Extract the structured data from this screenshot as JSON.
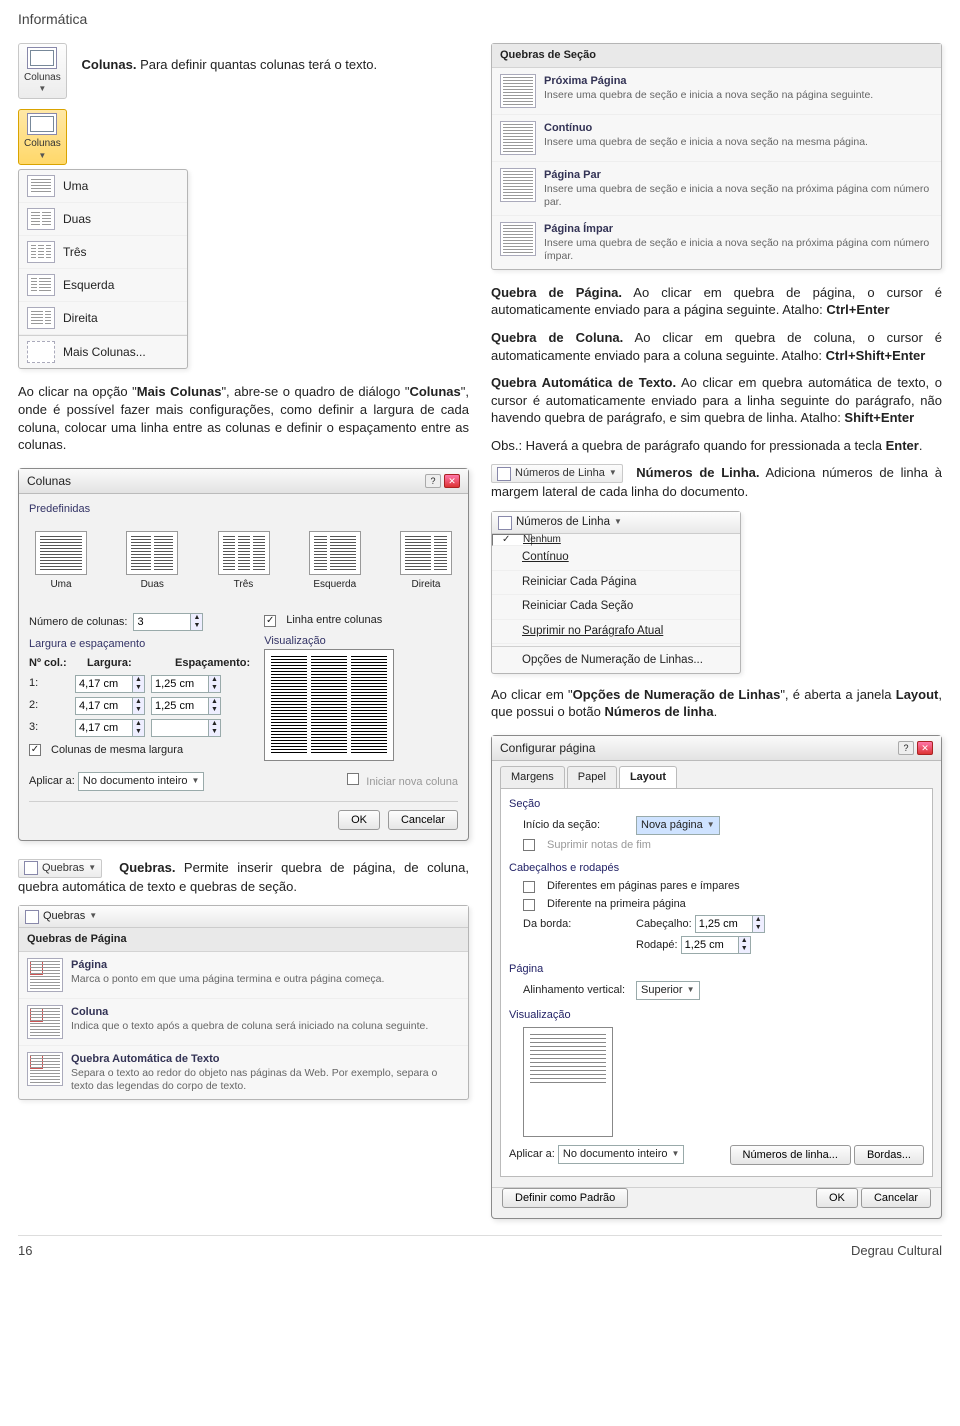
{
  "page_header": "Informática",
  "page_number": "16",
  "page_footer": "Degrau Cultural",
  "left": {
    "colunas_intro": {
      "label": "Colunas.",
      "text": " Para definir quantas colunas terá o texto.",
      "button": "Colunas"
    },
    "column_menu": {
      "button": "Colunas",
      "items": [
        "Uma",
        "Duas",
        "Três",
        "Esquerda",
        "Direita"
      ],
      "more": "Mais Colunas..."
    },
    "more_columns_para": {
      "p1a": "Ao clicar na opção \"",
      "p1b": "Mais Colunas",
      "p1c": "\", abre-se o quadro de diálogo \"",
      "p1d": "Colunas",
      "p1e": "\", onde é possível fazer mais configurações, como definir a largura de cada coluna, colocar uma linha entre as colunas e definir o espaçamento entre as colunas."
    },
    "columns_dialog": {
      "title": "Colunas",
      "predef_label": "Predefinidas",
      "presets": [
        "Uma",
        "Duas",
        "Três",
        "Esquerda",
        "Direita"
      ],
      "numcols_label": "Número de colunas:",
      "numcols_value": "3",
      "linha_entre": "Linha entre colunas",
      "larg_esp_label": "Largura e espaçamento",
      "visual_label": "Visualização",
      "col_no": "Nº col.:",
      "largura": "Largura:",
      "espac": "Espaçamento:",
      "rows": [
        {
          "n": "1:",
          "w": "4,17 cm",
          "s": "1,25 cm"
        },
        {
          "n": "2:",
          "w": "4,17 cm",
          "s": "1,25 cm"
        },
        {
          "n": "3:",
          "w": "4,17 cm",
          "s": ""
        }
      ],
      "mesma_larg": "Colunas de mesma largura",
      "aplicar_label": "Aplicar a:",
      "aplicar_value": "No documento inteiro",
      "iniciar_nova": "Iniciar nova coluna",
      "ok": "OK",
      "cancel": "Cancelar"
    },
    "quebras_para": {
      "btn": "Quebras",
      "b": "Quebras.",
      "t": " Permite inserir quebra de página, de coluna, quebra automática de texto e quebras de seção."
    },
    "quebras_gallery": {
      "button": "Quebras",
      "head": "Quebras de Página",
      "items": [
        {
          "t": "Página",
          "d": "Marca o ponto em que uma página termina e outra página começa."
        },
        {
          "t": "Coluna",
          "d": "Indica que o texto após a quebra de coluna será iniciado na coluna seguinte."
        },
        {
          "t": "Quebra Automática de Texto",
          "d": "Separa o texto ao redor do objeto nas páginas da Web. Por exemplo, separa o texto das legendas do corpo de texto."
        }
      ]
    }
  },
  "right": {
    "section_gallery": {
      "head": "Quebras de Seção",
      "items": [
        {
          "t": "Próxima Página",
          "d": "Insere uma quebra de seção e inicia a nova seção na página seguinte."
        },
        {
          "t": "Contínuo",
          "d": "Insere uma quebra de seção e inicia a nova seção na mesma página."
        },
        {
          "t": "Página Par",
          "d": "Insere uma quebra de seção e inicia a nova seção na próxima página com número par."
        },
        {
          "t": "Página Ímpar",
          "d": "Insere uma quebra de seção e inicia a nova seção na próxima página com número ímpar."
        }
      ]
    },
    "quebra_pagina": {
      "b": "Quebra de Página.",
      "t": " Ao clicar em quebra de página, o cursor é automaticamente enviado para a página seguinte. Atalho: ",
      "s": "Ctrl+Enter"
    },
    "quebra_coluna": {
      "b": "Quebra de Coluna.",
      "t": " Ao clicar em quebra de coluna, o cursor é automaticamente enviado para a coluna seguinte. Atalho: ",
      "s": "Ctrl+Shift+Enter"
    },
    "quebra_auto": {
      "b": "Quebra Automática de Texto.",
      "t": " Ao clicar em quebra automática de texto, o cursor é automaticamente enviado para a linha seguinte do parágrafo, não havendo quebra de parágrafo, e sim quebra de linha. Atalho: ",
      "s": "Shift+Enter"
    },
    "obs": {
      "p": "Obs.: Haverá a quebra de parágrafo quando for pressionada a tecla ",
      "b": "Enter",
      "end": "."
    },
    "num_linha": {
      "btn": "Números de Linha",
      "b": "Números de Linha.",
      "t": " Adiciona números de linha à margem lateral de cada linha do documento."
    },
    "ln_menu": {
      "head": "Números de Linha",
      "items": [
        "Nenhum",
        "Contínuo",
        "Reiniciar Cada Página",
        "Reiniciar Cada Seção",
        "Suprimir no Parágrafo Atual"
      ],
      "more": "Opções de Numeração de Linhas..."
    },
    "opcoes_para": {
      "p1": "Ao clicar em \"",
      "b1": "Opções de Numeração de Linhas",
      "p2": "\", é aberta a janela ",
      "b2": "Layout",
      "p3": ", que possui o botão ",
      "b3": "Números de linha",
      "p4": "."
    },
    "page_setup": {
      "title": "Configurar página",
      "tabs": [
        "Margens",
        "Papel",
        "Layout"
      ],
      "secao": "Seção",
      "inicio_secao_lbl": "Início da seção:",
      "inicio_secao_val": "Nova página",
      "suprimir": "Suprimir notas de fim",
      "cabe_rod": "Cabeçalhos e rodapés",
      "dif_par_impar": "Diferentes em páginas pares e ímpares",
      "dif_primeira": "Diferente na primeira página",
      "da_borda": "Da borda:",
      "cabecalho_lbl": "Cabeçalho:",
      "cabecalho_val": "1,25 cm",
      "rodape_lbl": "Rodapé:",
      "rodape_val": "1,25 cm",
      "pagina": "Página",
      "alinh_vert_lbl": "Alinhamento vertical:",
      "alinh_vert_val": "Superior",
      "visual": "Visualização",
      "aplicar_lbl": "Aplicar a:",
      "aplicar_val": "No documento inteiro",
      "btn_num_linha": "Números de linha...",
      "btn_bordas": "Bordas...",
      "btn_padrao": "Definir como Padrão",
      "ok": "OK",
      "cancel": "Cancelar"
    }
  }
}
